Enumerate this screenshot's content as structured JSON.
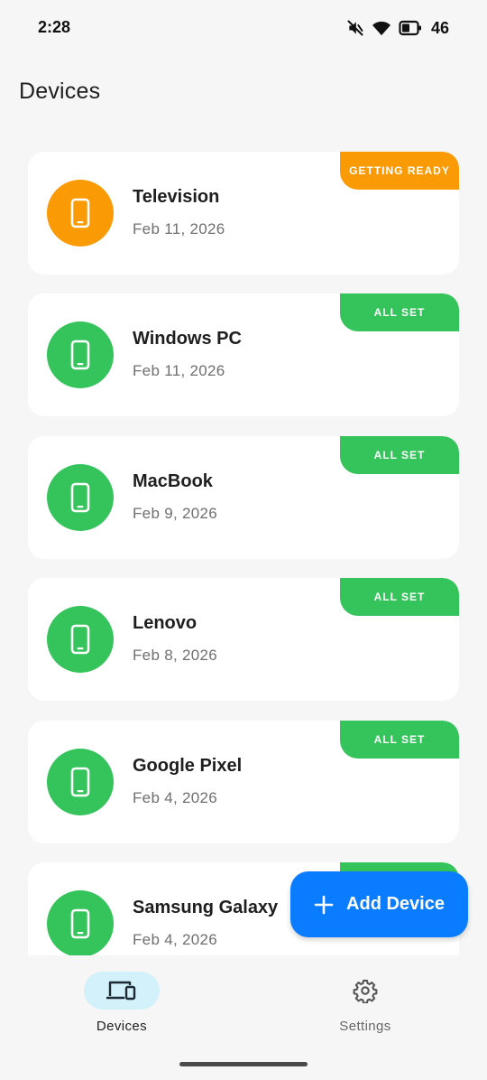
{
  "status_bar": {
    "time": "2:28",
    "battery_level": "46",
    "icons": [
      "mute-icon",
      "wifi-icon",
      "battery-icon"
    ]
  },
  "header": {
    "title": "Devices"
  },
  "colors": {
    "getting_ready": "#fa9a05",
    "all_set": "#35c45b",
    "accent": "#0a7cff",
    "nav_active_pill": "#d3f1fb"
  },
  "devices": [
    {
      "name": "Television",
      "date": "Feb 11, 2026",
      "status": "GETTING READY",
      "status_color": "#fa9a05",
      "icon": "phone-icon"
    },
    {
      "name": "Windows PC",
      "date": "Feb 11, 2026",
      "status": "ALL SET",
      "status_color": "#35c45b",
      "icon": "phone-icon"
    },
    {
      "name": "MacBook",
      "date": "Feb 9, 2026",
      "status": "ALL SET",
      "status_color": "#35c45b",
      "icon": "phone-icon"
    },
    {
      "name": "Lenovo",
      "date": "Feb 8, 2026",
      "status": "ALL SET",
      "status_color": "#35c45b",
      "icon": "phone-icon"
    },
    {
      "name": "Google Pixel",
      "date": "Feb 4, 2026",
      "status": "ALL SET",
      "status_color": "#35c45b",
      "icon": "phone-icon"
    },
    {
      "name": "Samsung Galaxy",
      "date": "Feb 4, 2026",
      "status": "",
      "status_color": "#35c45b",
      "icon": "phone-icon"
    }
  ],
  "fab": {
    "label": "Add Device",
    "icon": "plus-icon"
  },
  "bottom_nav": {
    "items": [
      {
        "label": "Devices",
        "icon": "devices-icon",
        "active": true
      },
      {
        "label": "Settings",
        "icon": "gear-icon",
        "active": false
      }
    ]
  }
}
